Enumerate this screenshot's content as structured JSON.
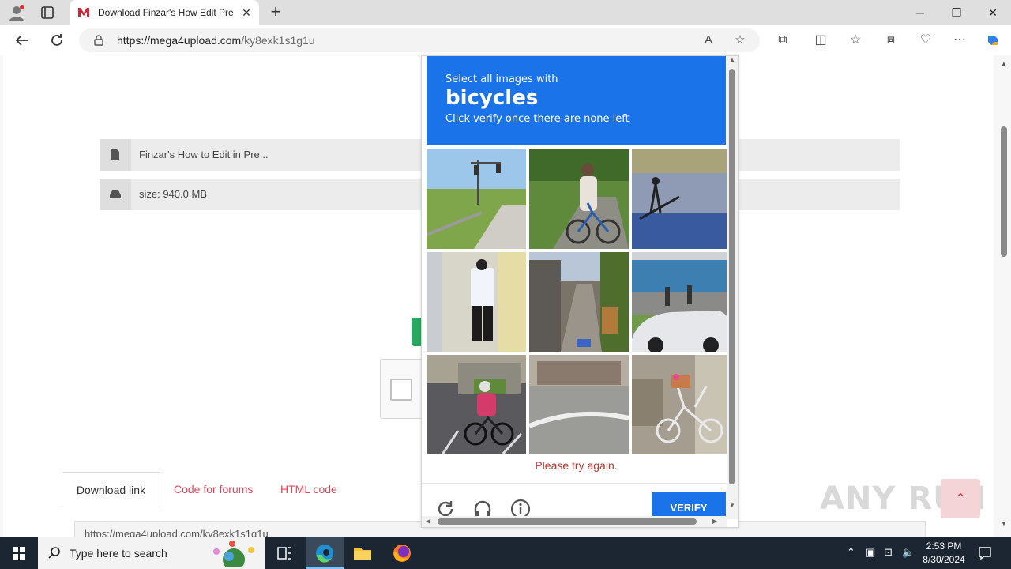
{
  "browser": {
    "tab_title": "Download Finzar's How Edit Prem",
    "url_domain": "https://mega4upload.com",
    "url_path": "/ky8exk1s1g1u"
  },
  "page": {
    "file_name": "Finzar's How to Edit in Pre...",
    "file_size": "size: 940.0 MB",
    "tabs": [
      "Download link",
      "Code for forums",
      "HTML code"
    ],
    "link_value": "https://mega4upload.com/ky8exk1s1g1u"
  },
  "captcha": {
    "instruction": "Select all images with",
    "target": "bicycles",
    "subtext": "Click verify once there are none left",
    "error": "Please try again.",
    "verify_label": "VERIFY"
  },
  "watermark": "ANY RUN",
  "taskbar": {
    "search_placeholder": "Type here to search",
    "time": "2:53 PM",
    "date": "8/30/2024"
  },
  "colors": {
    "captcha_blue": "#1a73e8",
    "link_red": "#e3445a",
    "error_red": "#b53a30",
    "download_green": "#27a961"
  }
}
